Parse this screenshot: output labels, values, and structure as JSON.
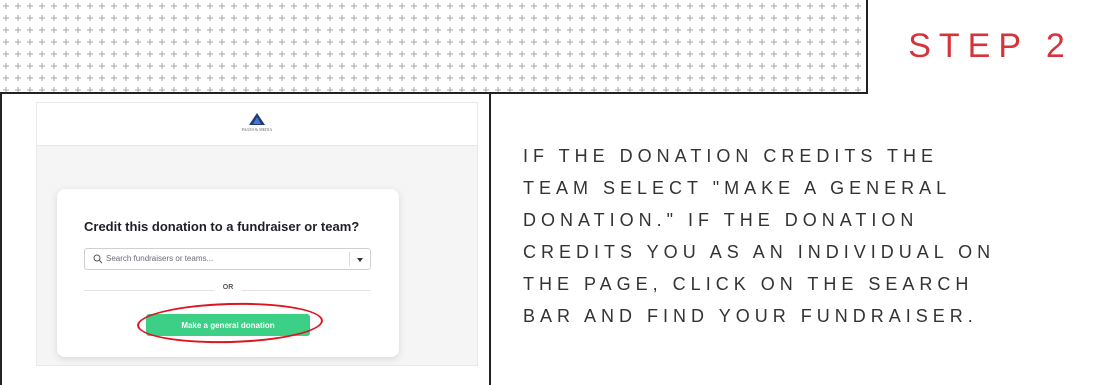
{
  "header": {
    "step_title": "STEP 2"
  },
  "screenshot": {
    "logo_text": "PAGES & MEDIA",
    "card": {
      "title": "Credit this donation to a fundraiser or team?",
      "search": {
        "placeholder": "Search fundraisers or teams..."
      },
      "or_label": "OR",
      "general_donation_button": "Make a general donation"
    },
    "colors": {
      "button": "#3ccf86",
      "highlight_circle": "#e0141e",
      "step_title": "#d4343c"
    }
  },
  "instructions": {
    "text": "IF THE DONATION CREDITS THE\nTEAM SELECT \"MAKE A GENERAL\nDONATION.\" IF THE DONATION\nCREDITS YOU AS AN INDIVIDUAL ON\nTHE PAGE, CLICK ON THE SEARCH\nBAR AND FIND YOUR FUNDRAISER."
  }
}
